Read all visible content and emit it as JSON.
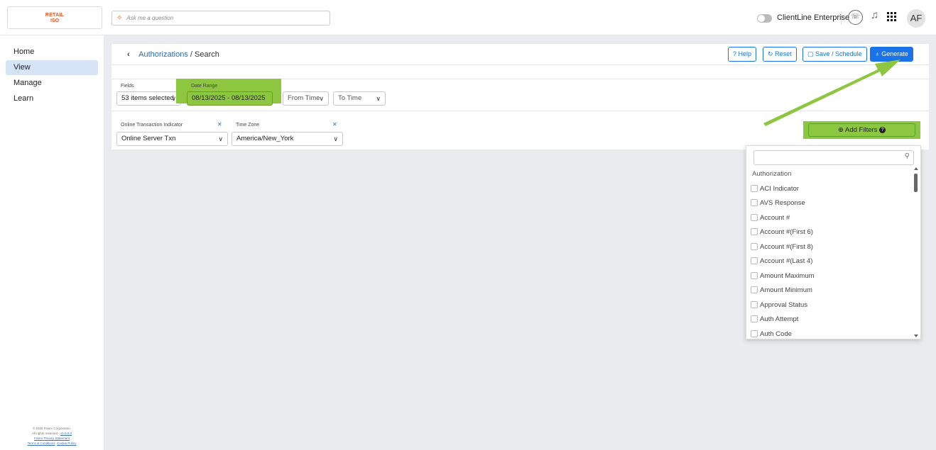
{
  "logo": {
    "line1": "RETAIL",
    "line2": "ISO"
  },
  "ask": {
    "placeholder": "Ask me a question"
  },
  "header": {
    "enterprise_label": "ClientLine Enterprise",
    "avatar_initials": "AF"
  },
  "sidebar": {
    "items": [
      {
        "label": "Home"
      },
      {
        "label": "View"
      },
      {
        "label": "Manage"
      },
      {
        "label": "Learn"
      }
    ]
  },
  "footer": {
    "copyright": "© 2025 Fiserv Corporation.",
    "rights": "All rights reserved -",
    "version": "v1.0.0.0",
    "privacy": "Fiserv Privacy Statement",
    "terms": "Terms & Conditions",
    "cookie": "Cookie Policy"
  },
  "breadcrumb": {
    "link": "Authorizations",
    "current": " / Search"
  },
  "toolbar": {
    "help": "Help",
    "reset": "Reset",
    "save": "Save / Schedule",
    "generate": "Generate"
  },
  "filters": {
    "fields_label": "Fields",
    "fields_value": "53 items selected",
    "date_label": "Date Range",
    "date_value": "08/13/2025 - 08/13/2025",
    "from_time": "From Time",
    "to_time": "To Time",
    "oti_label": "Online Transaction Indicator",
    "oti_value": "Online Server Txn",
    "tz_label": "Time Zone",
    "tz_value": "America/New_York",
    "add_filters": "Add Filters"
  },
  "dropdown": {
    "group": "Authorization",
    "items": [
      "ACI Indicator",
      "AVS Response",
      "Account #",
      "Account #(First 6)",
      "Account #(First 8)",
      "Account #(Last 4)",
      "Amount Maximum",
      "Amount Minimum",
      "Approval Status",
      "Auth Attempt",
      "Auth Code"
    ]
  },
  "colors": {
    "accent": "#1a73e8",
    "highlight": "#8dc63f",
    "brand": "#e8552a"
  }
}
